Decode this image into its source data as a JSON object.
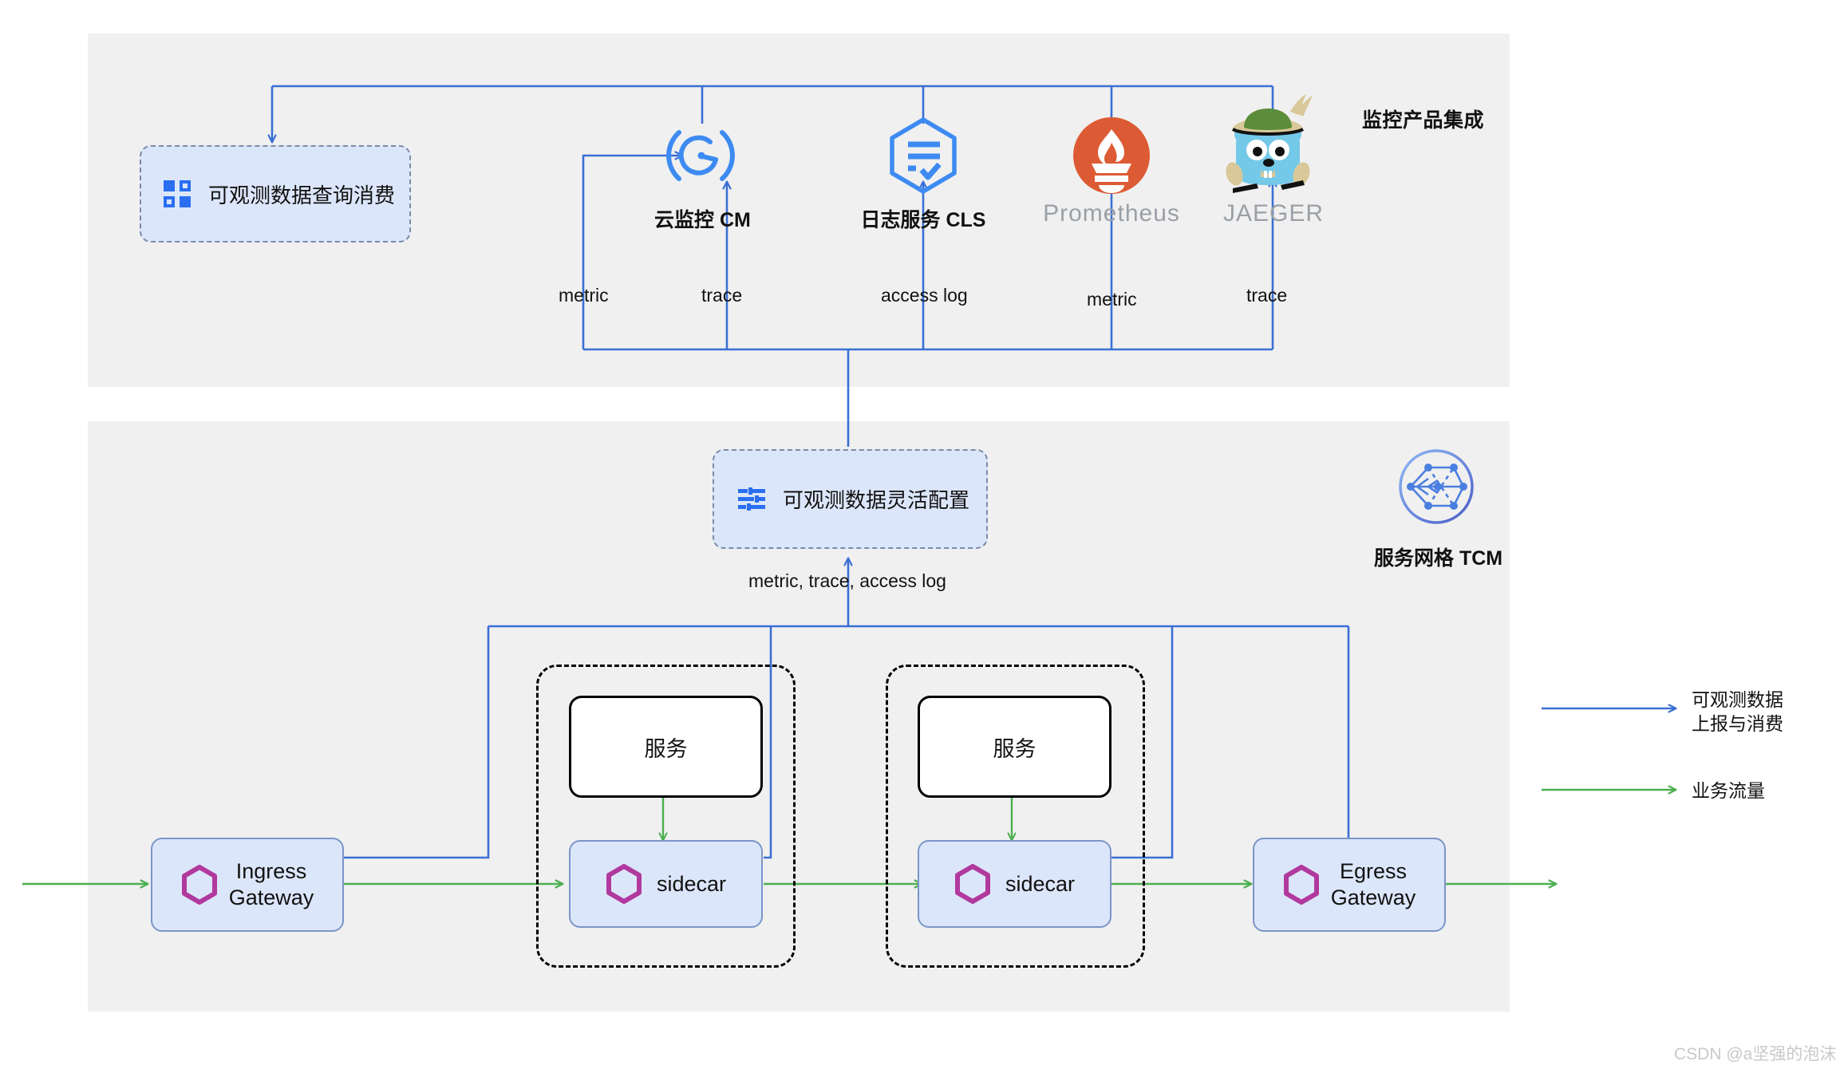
{
  "panels": {
    "top": {
      "title": "监控产品集成"
    },
    "bottom": {
      "title": "服务网格 TCM"
    }
  },
  "boxes": {
    "query": {
      "label": "可观测数据查询消费",
      "icon": "grid-squares-icon"
    },
    "config": {
      "label": "可观测数据灵活配置",
      "icon": "sliders-icon"
    }
  },
  "products": [
    {
      "name": "云监控 CM",
      "icon": "cloud-monitor-gauge-icon",
      "muted": false
    },
    {
      "name": "日志服务 CLS",
      "icon": "cls-hexagon-doc-icon",
      "muted": false
    },
    {
      "name": "Prometheus",
      "icon": "prometheus-logo-icon",
      "muted": true
    },
    {
      "name": "JAEGER",
      "icon": "jaeger-gopher-icon",
      "muted": true
    }
  ],
  "wire_labels": {
    "cm_metric": "metric",
    "cm_trace": "trace",
    "cls_access_log": "access log",
    "prom_metric": "metric",
    "jaeger_trace": "trace",
    "config_in": "metric, trace, access log"
  },
  "mesh": {
    "ingress": {
      "label_line1": "Ingress",
      "label_line2": "Gateway",
      "icon": "hexagon-icon"
    },
    "egress": {
      "label_line1": "Egress",
      "label_line2": "Gateway",
      "icon": "hexagon-icon"
    },
    "pods": [
      {
        "service": "服务",
        "sidecar": "sidecar",
        "icon": "hexagon-icon"
      },
      {
        "service": "服务",
        "sidecar": "sidecar",
        "icon": "hexagon-icon"
      }
    ],
    "tcm_icon": "tcm-mesh-circle-icon"
  },
  "legend": [
    {
      "color": "#3b6fd4",
      "line1": "可观测数据",
      "line2": "上报与消费"
    },
    {
      "color": "#4caf50",
      "line1": "业务流量",
      "line2": ""
    }
  ],
  "watermark": "CSDN @a坚强的泡沫",
  "colors": {
    "blue_wire": "#3b6fd4",
    "green_wire": "#4caf50",
    "panel_bg": "#f0f0f0",
    "box_fill": "#dce6fa",
    "hexagon_purple": "#b1399e",
    "prometheus_orange": "#dd5b34",
    "jaeger_blue": "#74c8e8"
  }
}
